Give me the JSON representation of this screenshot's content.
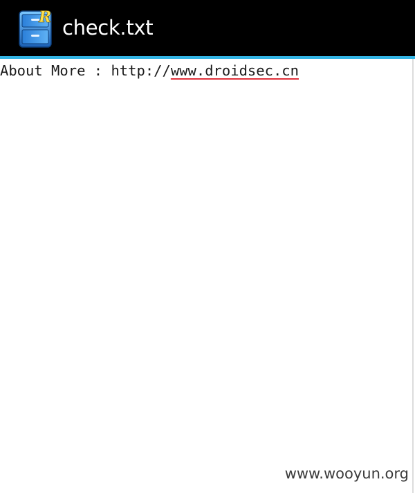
{
  "app": {
    "title": "check.txt",
    "icon": "root-explorer-cabinet-icon"
  },
  "document": {
    "prefix_text": "About More : http://",
    "link_text": "www.droidsec.cn"
  },
  "watermark": {
    "text": "www.wooyun.org"
  },
  "colors": {
    "action_bar": "#000000",
    "accent": "#33b5e5",
    "spellcheck_underline": "#e0303a",
    "background": "#ffffff"
  }
}
